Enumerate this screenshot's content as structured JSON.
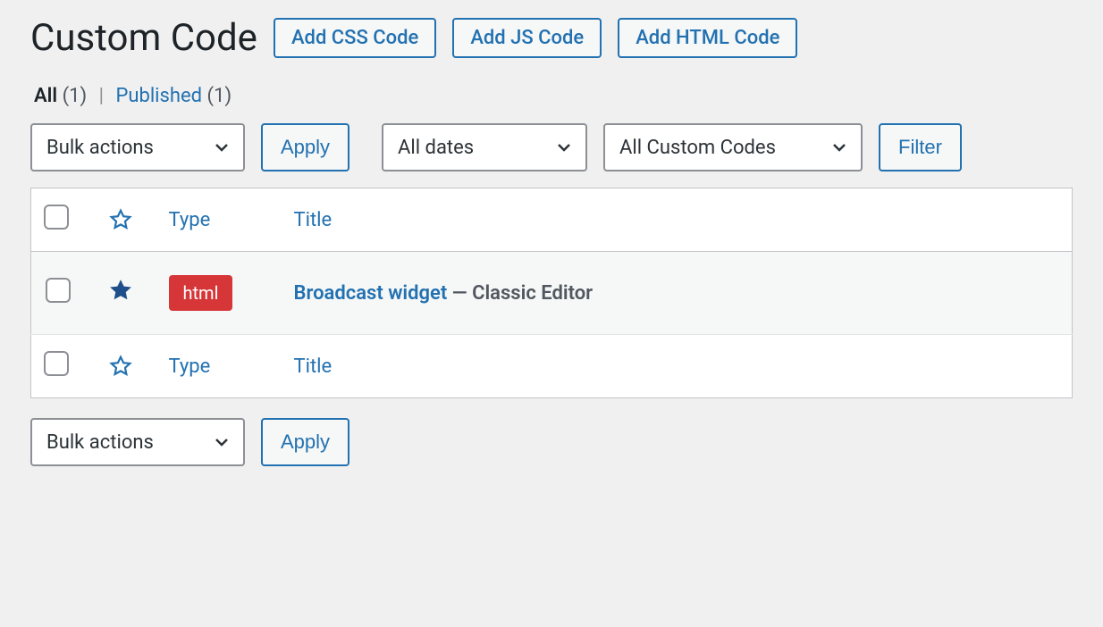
{
  "heading": {
    "title": "Custom Code",
    "actions": {
      "add_css": "Add CSS Code",
      "add_js": "Add JS Code",
      "add_html": "Add HTML Code"
    }
  },
  "filters": {
    "all_label": "All",
    "all_count": "(1)",
    "separator": "|",
    "published_label": "Published",
    "published_count": "(1)"
  },
  "tablenav": {
    "bulk_actions": "Bulk actions",
    "apply": "Apply",
    "all_dates": "All dates",
    "all_custom_codes": "All Custom Codes",
    "filter": "Filter"
  },
  "columns": {
    "type": "Type",
    "title": "Title"
  },
  "rows": [
    {
      "starred": true,
      "type_label": "html",
      "type_color": "#d63638",
      "title": "Broadcast widget",
      "suffix": " — Classic Editor"
    }
  ],
  "icons": {
    "star": "star-icon",
    "chevron": "chevron-down-icon"
  },
  "colors": {
    "link": "#2271b1",
    "badge": "#d63638",
    "star_fill": "#1e4f8a"
  }
}
